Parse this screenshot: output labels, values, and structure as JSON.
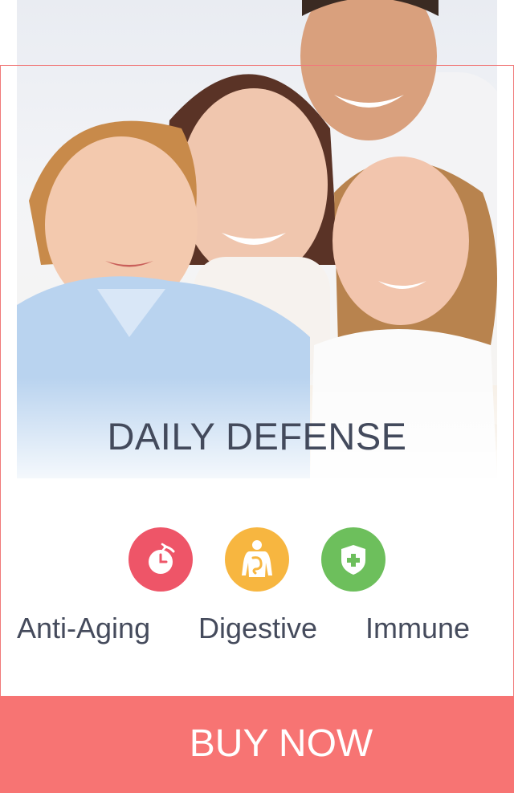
{
  "hero": {
    "title": "DAILY DEFENSE",
    "image": "family-photo"
  },
  "features": [
    {
      "label": "Anti-Aging",
      "icon": "stopwatch-icon",
      "color": "#ee5568"
    },
    {
      "label": "Digestive",
      "icon": "digestive-body-icon",
      "color": "#f7b640"
    },
    {
      "label": "Immune",
      "icon": "shield-plus-icon",
      "color": "#6dbf5c"
    }
  ],
  "cta": {
    "label": "BUY NOW",
    "color": "#f77473"
  }
}
